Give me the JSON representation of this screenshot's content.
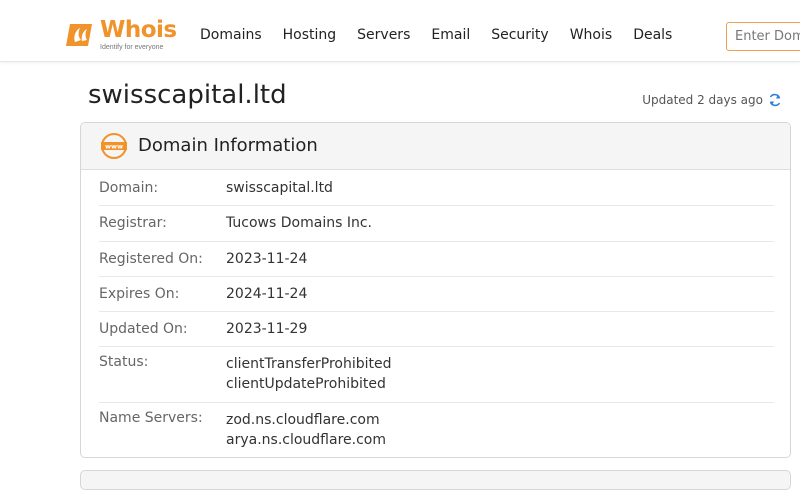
{
  "header": {
    "logo": {
      "word": "Whois",
      "tagline": "Identify for everyone"
    },
    "nav": [
      {
        "label": "Domains"
      },
      {
        "label": "Hosting"
      },
      {
        "label": "Servers"
      },
      {
        "label": "Email"
      },
      {
        "label": "Security"
      },
      {
        "label": "Whois"
      },
      {
        "label": "Deals"
      }
    ],
    "search": {
      "placeholder": "Enter Domain or IP"
    }
  },
  "page": {
    "title": "swisscapital.ltd",
    "updated": "Updated 2 days ago"
  },
  "card": {
    "title": "Domain Information",
    "icon": "www-icon",
    "rows": [
      {
        "label": "Domain:",
        "values": [
          "swisscapital.ltd"
        ]
      },
      {
        "label": "Registrar:",
        "values": [
          "Tucows Domains Inc."
        ]
      },
      {
        "label": "Registered On:",
        "values": [
          "2023-11-24"
        ]
      },
      {
        "label": "Expires On:",
        "values": [
          "2024-11-24"
        ]
      },
      {
        "label": "Updated On:",
        "values": [
          "2023-11-29"
        ]
      },
      {
        "label": "Status:",
        "values": [
          "clientTransferProhibited",
          "clientUpdateProhibited"
        ]
      },
      {
        "label": "Name Servers:",
        "values": [
          "zod.ns.cloudflare.com",
          "arya.ns.cloudflare.com"
        ]
      }
    ]
  },
  "colors": {
    "brand": "#f0932b",
    "refresh": "#2f7fd6"
  }
}
